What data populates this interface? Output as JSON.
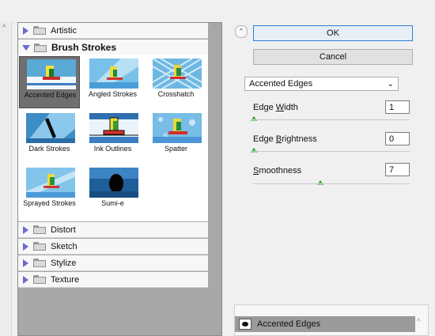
{
  "categories": {
    "artistic": "Artistic",
    "brush_strokes": "Brush Strokes",
    "distort": "Distort",
    "sketch": "Sketch",
    "stylize": "Stylize",
    "texture": "Texture"
  },
  "thumbnails": [
    {
      "label": "Accented Edges",
      "selected": true
    },
    {
      "label": "Angled Strokes",
      "selected": false
    },
    {
      "label": "Crosshatch",
      "selected": false
    },
    {
      "label": "Dark Strokes",
      "selected": false
    },
    {
      "label": "Ink Outlines",
      "selected": false
    },
    {
      "label": "Spatter",
      "selected": false
    },
    {
      "label": "Sprayed Strokes",
      "selected": false
    },
    {
      "label": "Sumi-e",
      "selected": false
    }
  ],
  "buttons": {
    "ok": "OK",
    "cancel": "Cancel"
  },
  "filter_select": {
    "value": "Accented Edges"
  },
  "params": [
    {
      "label_prefix": "Edge ",
      "label_underline": "W",
      "label_suffix": "idth",
      "value": "1"
    },
    {
      "label_prefix": "Edge ",
      "label_underline": "B",
      "label_suffix": "rightness",
      "value": "0"
    },
    {
      "label_prefix": "",
      "label_underline": "S",
      "label_suffix": "moothness",
      "value": "7"
    }
  ],
  "layers": [
    {
      "label": "Accented Edges"
    }
  ],
  "colors": {
    "accent": "#2b7fd8",
    "slider_thumb": "#2d8a2d",
    "expand_triangle": "#6b6bcf"
  }
}
